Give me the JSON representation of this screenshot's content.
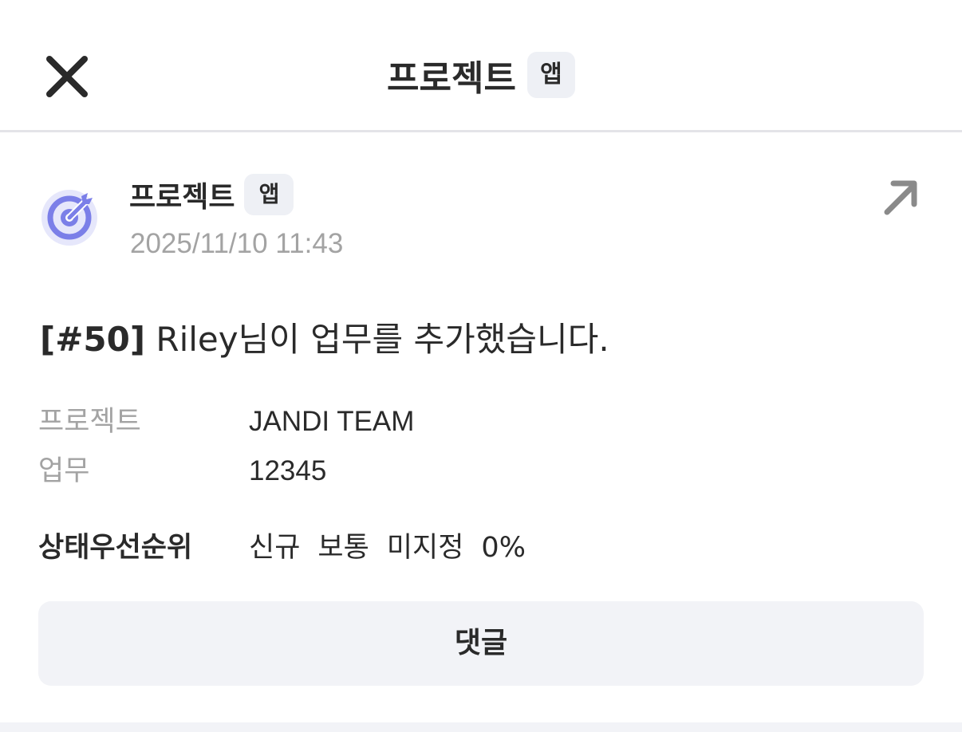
{
  "header": {
    "title": "프로젝트",
    "badge": "앱",
    "close_icon": "close-icon"
  },
  "message": {
    "sender": "프로젝트",
    "sender_badge": "앱",
    "timestamp": "2025/11/10 11:43",
    "avatar_icon": "target-icon",
    "open_icon": "arrow-up-right-icon",
    "tag": "[#50]",
    "text": " Riley님이 업무를 추가했습니다."
  },
  "fields": {
    "project_label": "프로젝트",
    "project_value": "JANDI TEAM",
    "task_label": "업무",
    "task_value": "12345",
    "status_label": "상태우선순위",
    "status_values": [
      "신규",
      "보통",
      "미지정",
      "0%"
    ]
  },
  "actions": {
    "comment_label": "댓글"
  },
  "colors": {
    "accent": "#7b7fe8",
    "badge_bg": "#eef0f5",
    "button_bg": "#f2f3f7",
    "muted_text": "#a3a3a3"
  }
}
